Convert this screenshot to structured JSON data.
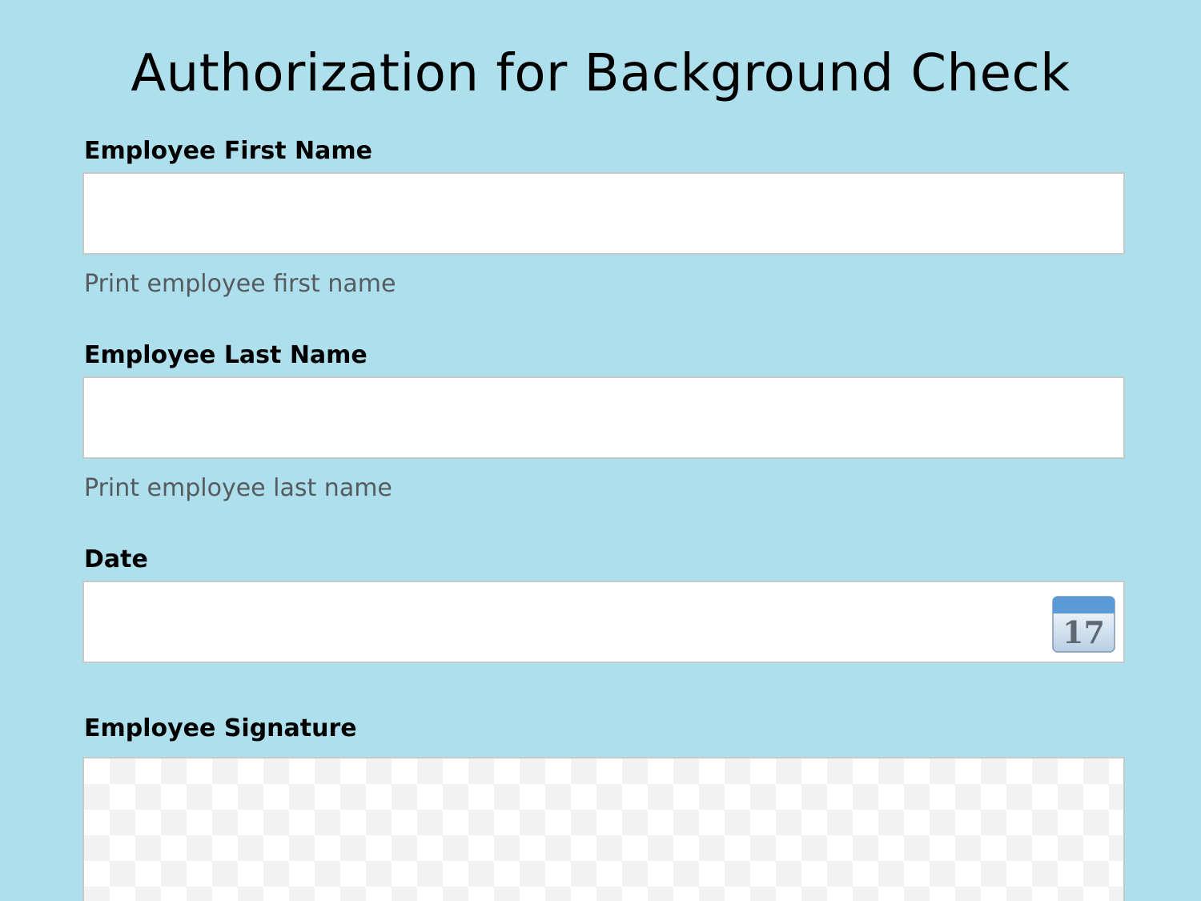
{
  "form": {
    "title": "Authorization for Background Check",
    "first_name": {
      "label": "Employee First Name",
      "value": "",
      "hint": "Print employee first name"
    },
    "last_name": {
      "label": "Employee Last Name",
      "value": "",
      "hint": "Print employee last name"
    },
    "date": {
      "label": "Date",
      "value": "",
      "calendar_icon": "calendar-icon",
      "calendar_day": "17"
    },
    "signature": {
      "label": "Employee Signature"
    }
  },
  "colors": {
    "background": "#aedfec",
    "field_background": "#ffffff",
    "field_border": "#c4c9cc",
    "hint_text": "#555b5e",
    "calendar_header": "#5b9ad8"
  }
}
